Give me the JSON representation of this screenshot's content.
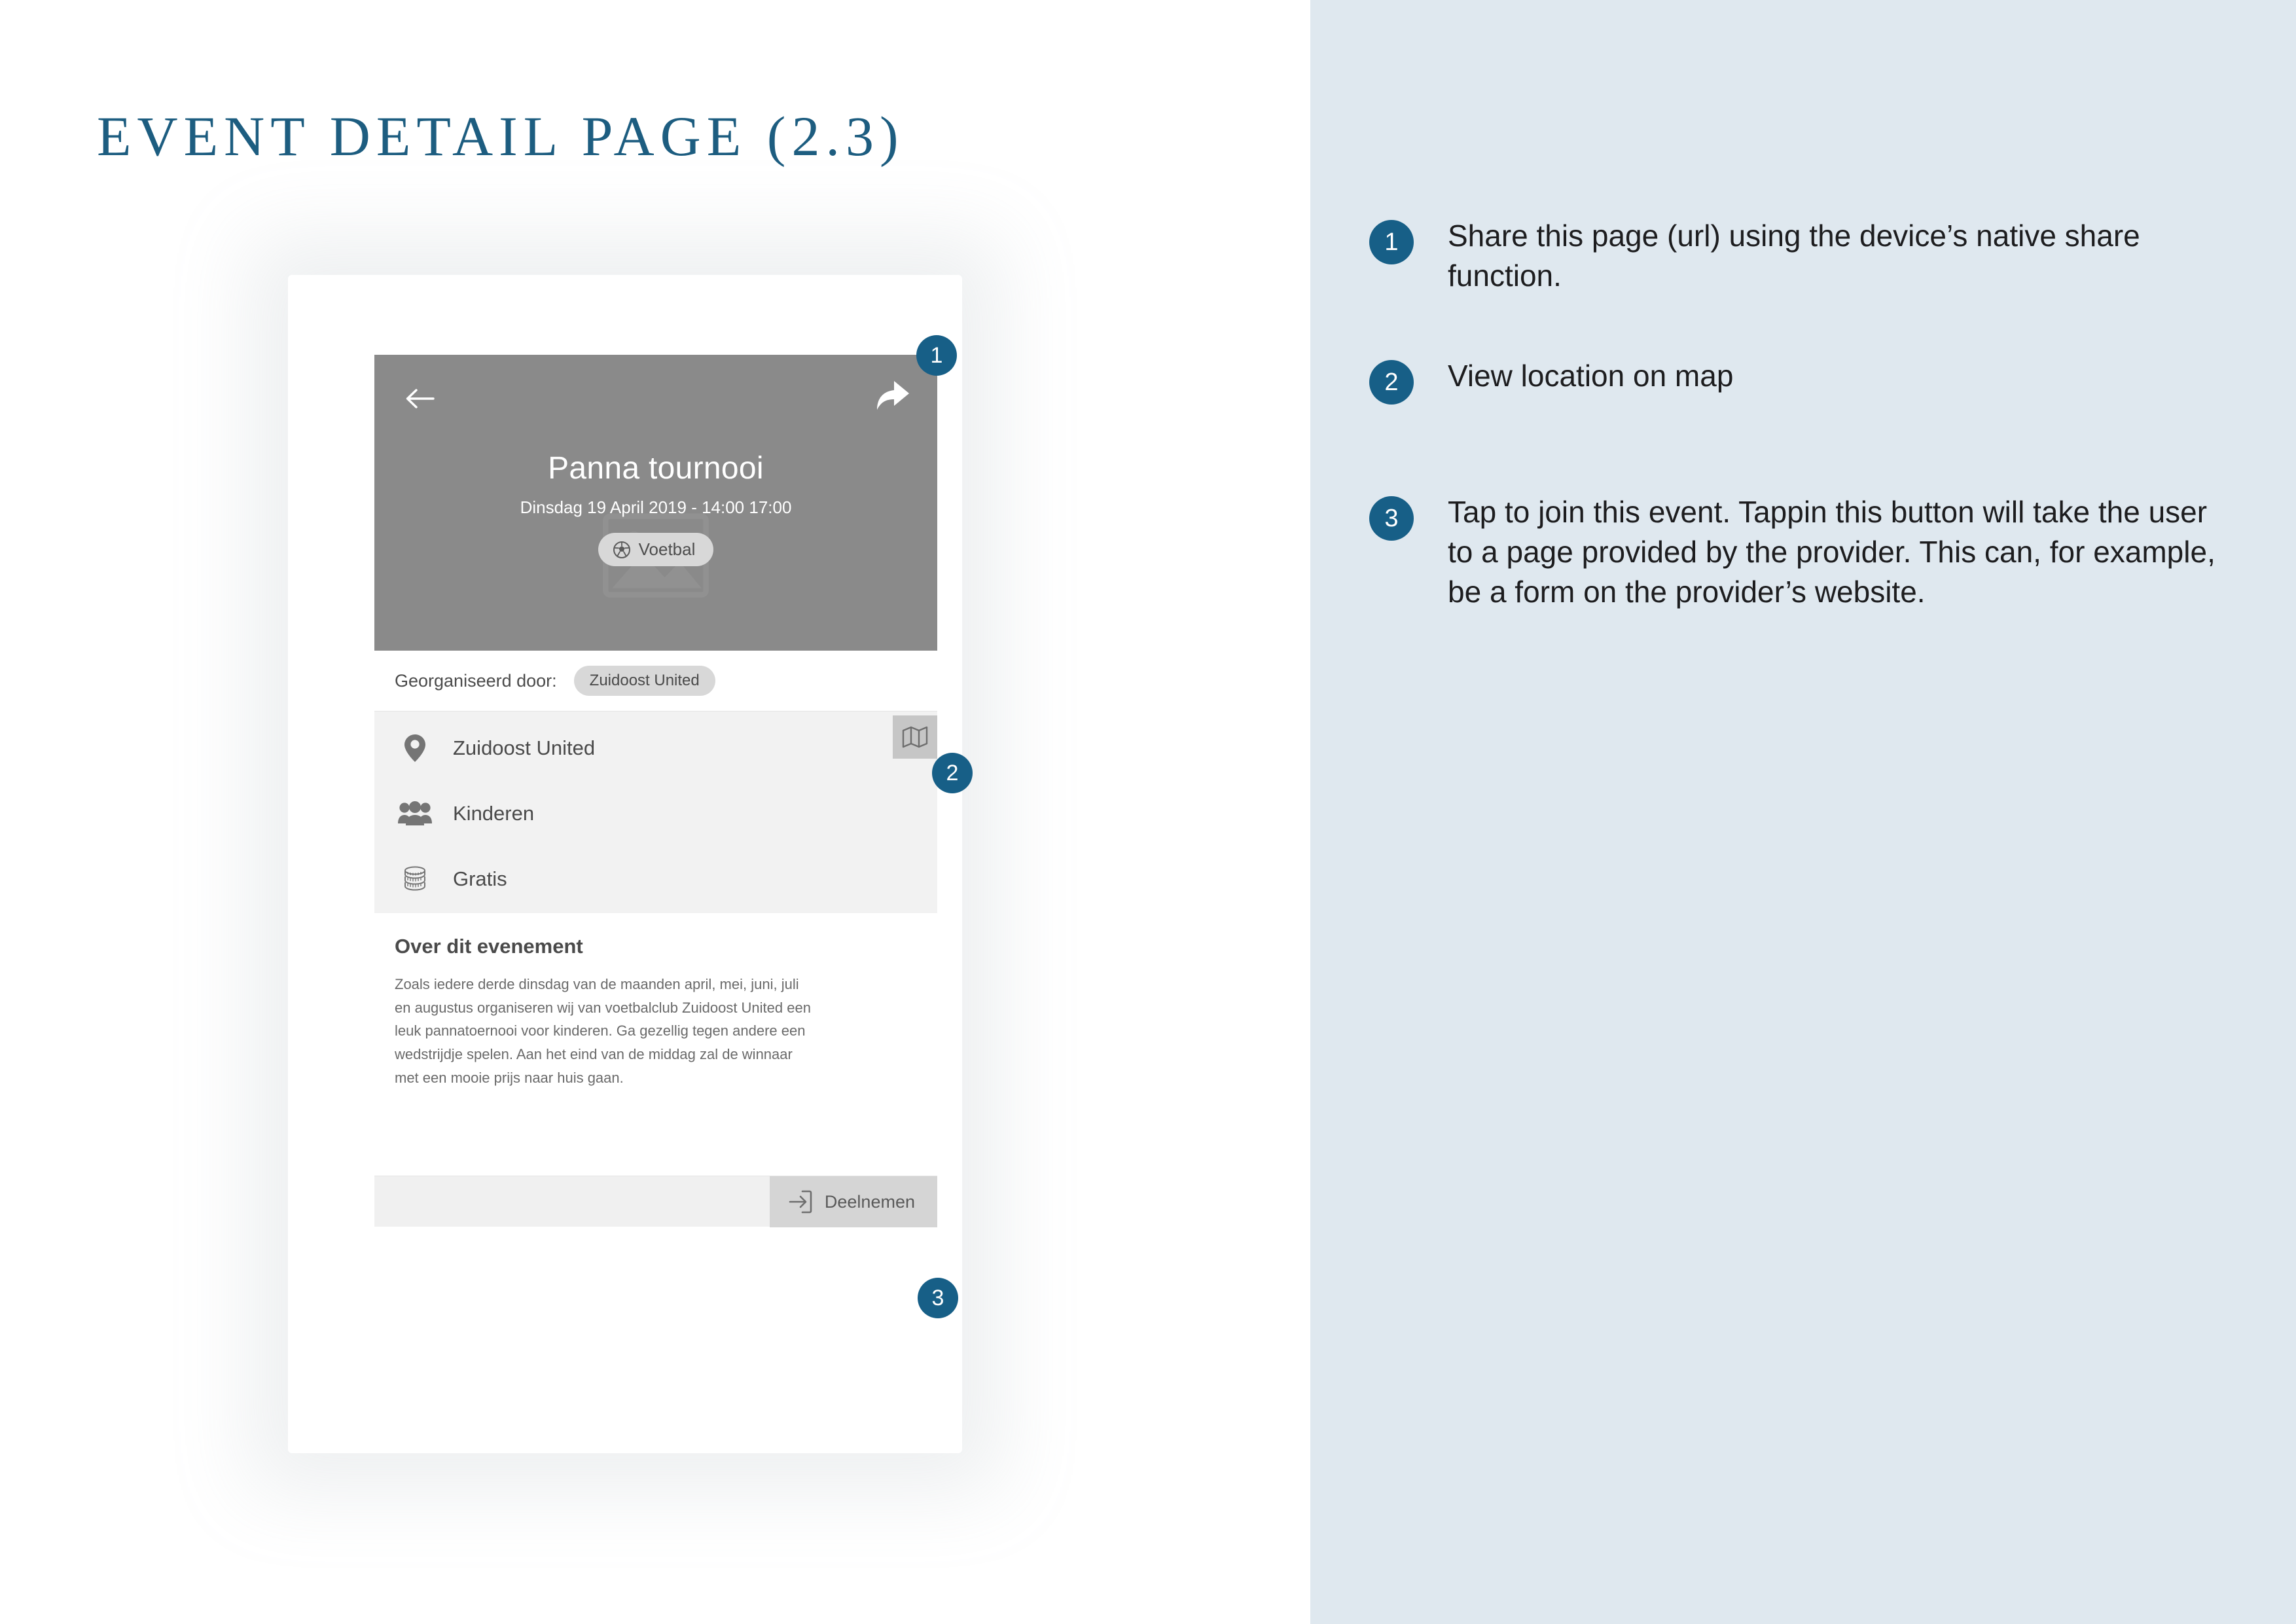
{
  "slide": {
    "title": "EVENT DETAIL PAGE (2.3)"
  },
  "phone": {
    "hero": {
      "back_icon": "back-arrow-icon",
      "share_icon": "share-arrow-icon",
      "title": "Panna tournooi",
      "date": "Dinsdag 19 April 2019 - 14:00 17:00",
      "tag_icon": "soccer-ball-icon",
      "tag_label": "Voetbal",
      "background_color": "#8a8a8a",
      "placeholder_icon": "image-placeholder-icon"
    },
    "organizer": {
      "label": "Georganiseerd door:",
      "name": "Zuidoost United"
    },
    "info_rows": [
      {
        "icon": "location-pin-icon",
        "label": "Zuidoost United"
      },
      {
        "icon": "people-group-icon",
        "label": "Kinderen"
      },
      {
        "icon": "coins-stack-icon",
        "label": "Gratis"
      }
    ],
    "map_button": {
      "icon": "map-icon"
    },
    "about": {
      "heading": "Over dit evenement",
      "body": "Zoals iedere derde dinsdag van de maanden april, mei, juni, juli en augustus organiseren wij van voetbalclub Zuidoost United een leuk pannatoernooi voor kinderen. Ga gezellig tegen andere een wedstrijdje spelen. Aan het eind van de middag zal de winnaar met een mooie prijs naar huis gaan."
    },
    "bottom_bar": {
      "join_icon": "enter-door-icon",
      "join_label": "Deelnemen"
    }
  },
  "callouts": {
    "one": "1",
    "two": "2",
    "three": "3"
  },
  "annotations": [
    {
      "number": "1",
      "text": "Share this page (url) using the device’s native share function."
    },
    {
      "number": "2",
      "text": "View location on map"
    },
    {
      "number": "3",
      "text": "Tap to join this event. Tappin this button will take the user to a page provided by the provider. This can, for example, be a form on the provider’s website."
    }
  ],
  "colors": {
    "accent": "#175f87",
    "panel_background": "#dfe8ef",
    "title": "#1d5d80",
    "hero": "#8a8a8a",
    "info_background": "#f2f2f2"
  }
}
